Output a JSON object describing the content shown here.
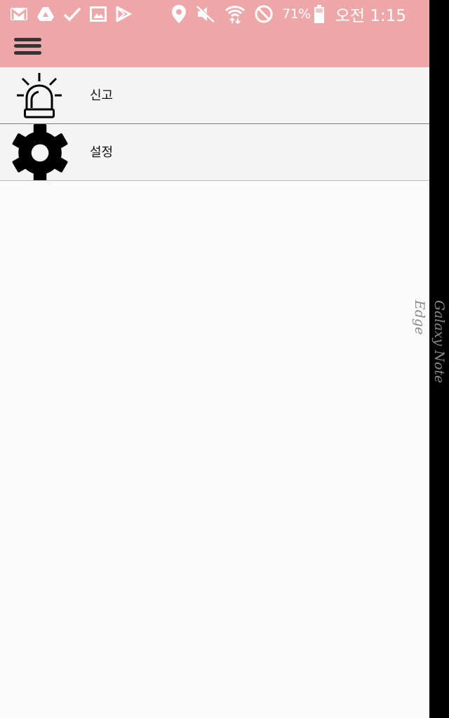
{
  "status_bar": {
    "battery_percent": "71%",
    "time": "오전 1:15",
    "notification_icons": [
      "gmail-icon",
      "drive-icon",
      "check-icon",
      "gallery-icon",
      "play-store-icon"
    ],
    "system_icons": [
      "location-icon",
      "mute-icon",
      "wifi-icon",
      "do-not-disturb-icon",
      "battery-icon"
    ]
  },
  "app_bar": {
    "menu_icon": "hamburger-menu-icon",
    "color": "#eda7a8"
  },
  "menu": {
    "items": [
      {
        "label": "신고",
        "icon": "siren-icon"
      },
      {
        "label": "설정",
        "icon": "gear-icon"
      }
    ]
  },
  "edge_panel": {
    "text": "Galaxy Note Edge"
  }
}
